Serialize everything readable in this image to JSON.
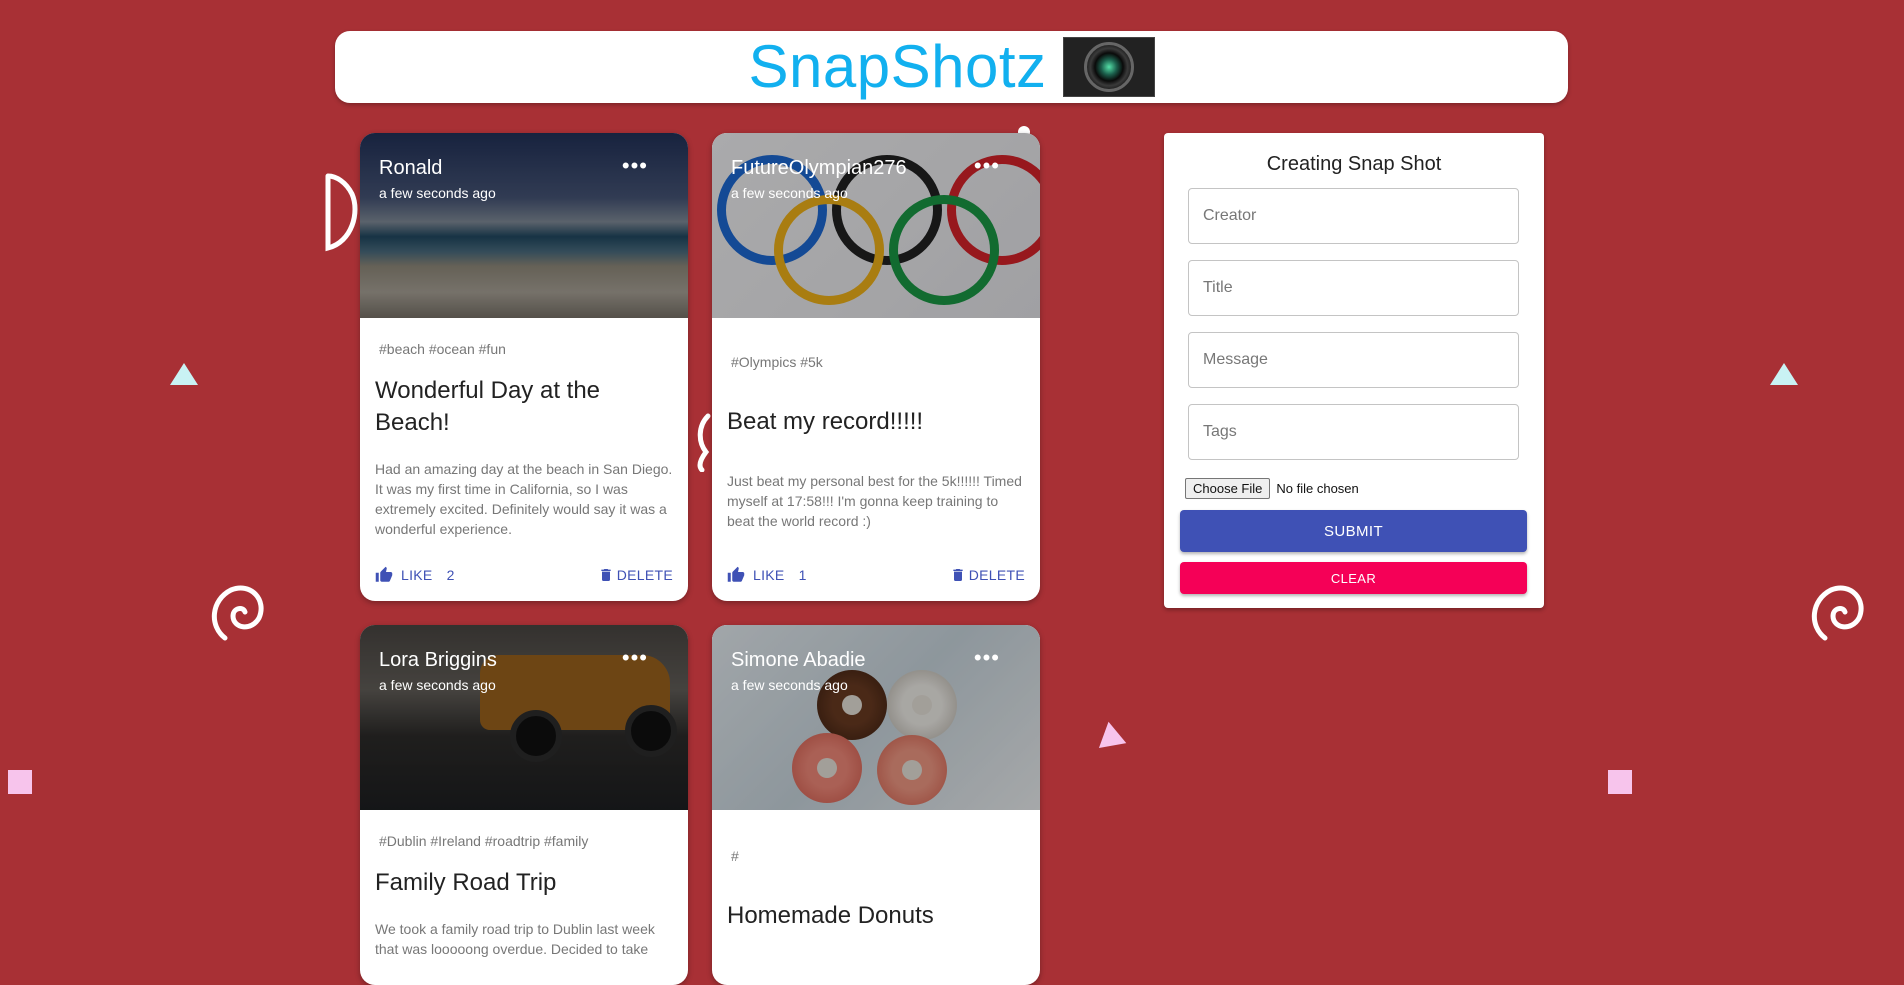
{
  "app": {
    "title": "SnapShotz"
  },
  "posts": [
    {
      "creator": "Ronald",
      "time": "a few seconds ago",
      "tags": "#beach #ocean #fun",
      "title": "Wonderful Day at the Beach!",
      "message": "Had an amazing day at the beach in San Diego. It was my first time in California, so I was extremely excited. Definitely would say it was a wonderful experience.",
      "like_label": "LIKE",
      "like_count": "2",
      "delete_label": "DELETE"
    },
    {
      "creator": "FutureOlympian276",
      "time": "a few seconds ago",
      "tags": "#Olympics #5k",
      "title": "Beat my record!!!!!",
      "message": "Just beat my personal best for the 5k!!!!!! Timed myself at 17:58!!! I'm gonna keep training to beat the world record :)",
      "like_label": "LIKE",
      "like_count": "1",
      "delete_label": "DELETE"
    },
    {
      "creator": "Lora Briggins",
      "time": "a few seconds ago",
      "tags": "#Dublin #Ireland #roadtrip #family",
      "title": "Family Road Trip",
      "message": "We took a family road trip to Dublin last week that was looooong overdue. Decided to take"
    },
    {
      "creator": "Simone Abadie",
      "time": "a few seconds ago",
      "tags": "#",
      "title": "Homemade Donuts"
    }
  ],
  "form": {
    "title": "Creating Snap Shot",
    "creator_placeholder": "Creator",
    "title_placeholder": "Title",
    "message_placeholder": "Message",
    "tags_placeholder": "Tags",
    "file_button": "Choose File",
    "file_status": "No file chosen",
    "submit_label": "SUBMIT",
    "clear_label": "CLEAR"
  },
  "colors": {
    "background": "#a83035",
    "brand": "#12b0ef",
    "primary": "#3f51b5",
    "secondary": "#f50057"
  },
  "icons": {
    "more": "more-horiz-icon",
    "like": "thumb-up-icon",
    "delete": "trash-icon"
  }
}
